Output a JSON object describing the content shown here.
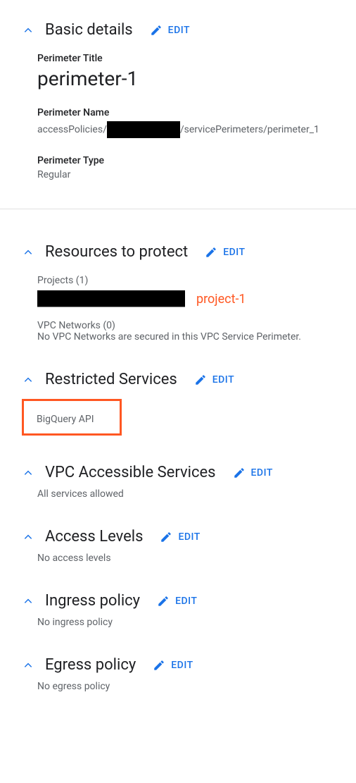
{
  "sections": {
    "basic": {
      "title": "Basic details",
      "edit": "EDIT",
      "perimeter_title_label": "Perimeter Title",
      "perimeter_title_value": "perimeter-1",
      "perimeter_name_label": "Perimeter Name",
      "perimeter_name_prefix": "accessPolicies/",
      "perimeter_name_suffix": "/servicePerimeters/perimeter_1",
      "perimeter_type_label": "Perimeter Type",
      "perimeter_type_value": "Regular"
    },
    "resources": {
      "title": "Resources to protect",
      "edit": "EDIT",
      "projects_label": "Projects (1)",
      "project_name": "project-1",
      "vpc_label": "VPC Networks (0)",
      "vpc_empty": "No VPC Networks are secured in this VPC Service Perimeter."
    },
    "restricted": {
      "title": "Restricted Services",
      "edit": "EDIT",
      "service": "BigQuery API"
    },
    "accessible": {
      "title": "VPC Accessible Services",
      "edit": "EDIT",
      "value": "All services allowed"
    },
    "levels": {
      "title": "Access Levels",
      "edit": "EDIT",
      "value": "No access levels"
    },
    "ingress": {
      "title": "Ingress policy",
      "edit": "EDIT",
      "value": "No ingress policy"
    },
    "egress": {
      "title": "Egress policy",
      "edit": "EDIT",
      "value": "No egress policy"
    }
  }
}
